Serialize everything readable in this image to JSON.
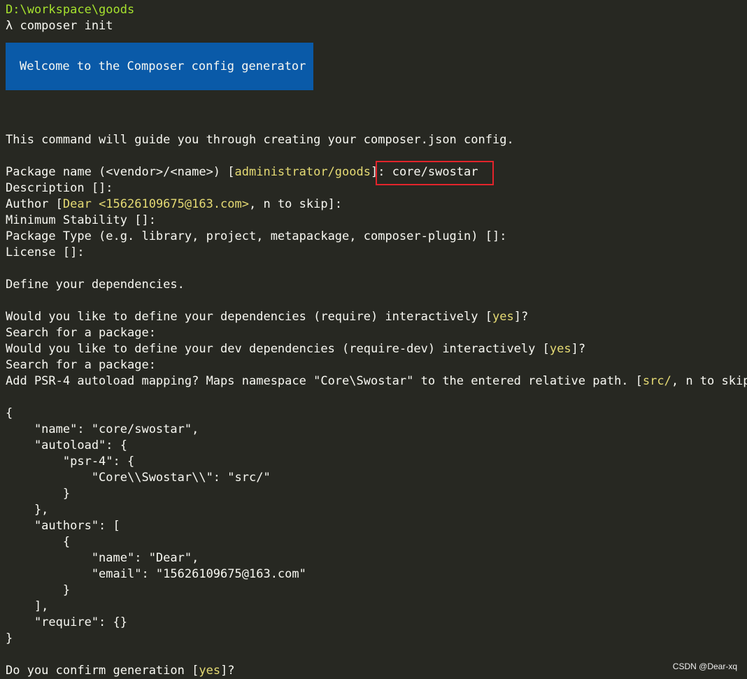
{
  "prompt": {
    "path": "D:\\workspace\\goods",
    "command": "λ composer init"
  },
  "banner": "Welcome to the Composer config generator",
  "intro": "This command will guide you through creating your composer.json config.",
  "package_name": {
    "prefix": "Package name (<vendor>/<name>) [",
    "default": "administrator/goods",
    "suffix": "]: ",
    "input": "core/swostar"
  },
  "description": "Description []:",
  "author": {
    "prefix": "Author [",
    "default": "Dear <15626109675@163.com>",
    "suffix": ", n to skip]:"
  },
  "min_stability": "Minimum Stability []:",
  "package_type": "Package Type (e.g. library, project, metapackage, composer-plugin) []:",
  "license": "License []:",
  "define_deps": "Define your dependencies.",
  "require_q": {
    "prefix": "Would you like to define your dependencies (require) interactively [",
    "default": "yes",
    "suffix": "]?"
  },
  "search_1": "Search for a package:",
  "require_dev_q": {
    "prefix": "Would you like to define your dev dependencies (require-dev) interactively [",
    "default": "yes",
    "suffix": "]?"
  },
  "search_2": "Search for a package:",
  "psr4_q": {
    "prefix": "Add PSR-4 autoload mapping? Maps namespace \"Core\\Swostar\" to the entered relative path. [",
    "default": "src/",
    "suffix": ", n to skip]:"
  },
  "json_lines": [
    "{",
    "    \"name\": \"core/swostar\",",
    "    \"autoload\": {",
    "        \"psr-4\": {",
    "            \"Core\\\\Swostar\\\\\": \"src/\"",
    "        }",
    "    },",
    "    \"authors\": [",
    "        {",
    "            \"name\": \"Dear\",",
    "            \"email\": \"15626109675@163.com\"",
    "        }",
    "    ],",
    "    \"require\": {}",
    "}"
  ],
  "confirm_q": {
    "prefix": "Do you confirm generation [",
    "default": "yes",
    "suffix": "]?"
  },
  "watermark": "CSDN @Dear-xq",
  "colors": {
    "background": "#272822",
    "text": "#f8f8f2",
    "path": "#a6e22e",
    "default_value": "#e6db74",
    "banner_bg": "#0a5aa8",
    "highlight_box": "#e3242b"
  }
}
